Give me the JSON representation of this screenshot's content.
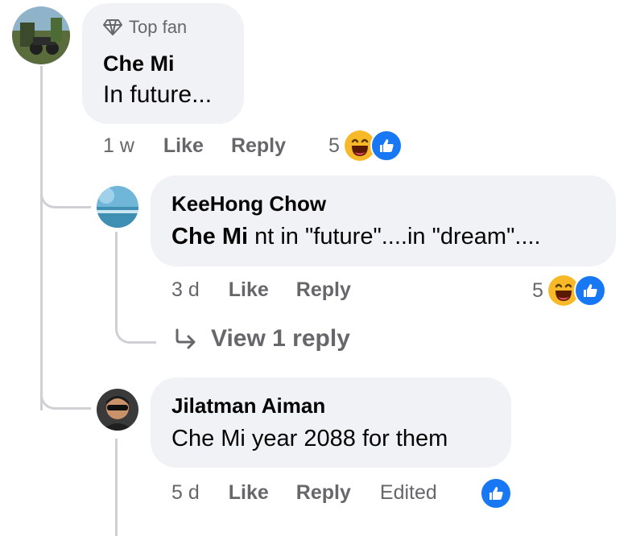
{
  "comments": [
    {
      "badge": "Top fan",
      "author": "Che Mi",
      "text": "In future...",
      "time": "1 w",
      "like_label": "Like",
      "reply_label": "Reply",
      "reaction_count": "5",
      "reactions": [
        "haha-icon",
        "like-icon"
      ]
    },
    {
      "author": "KeeHong Chow",
      "mention": "Che Mi",
      "text": " nt in \"future\"....in \"dream\"....",
      "time": "3 d",
      "like_label": "Like",
      "reply_label": "Reply",
      "reaction_count": "5",
      "reactions": [
        "haha-icon",
        "like-icon"
      ],
      "view_replies_label": "View 1 reply"
    },
    {
      "author": "Jilatman Aiman",
      "text": "Che Mi year 2088 for them",
      "time": "5 d",
      "like_label": "Like",
      "reply_label": "Reply",
      "edited_label": "Edited",
      "reactions": [
        "like-icon"
      ]
    }
  ],
  "colors": {
    "bubble": "#f0f2f5",
    "meta_text": "#65676b",
    "like_blue": "#1877f2",
    "haha_yellow": "#f7b928"
  }
}
